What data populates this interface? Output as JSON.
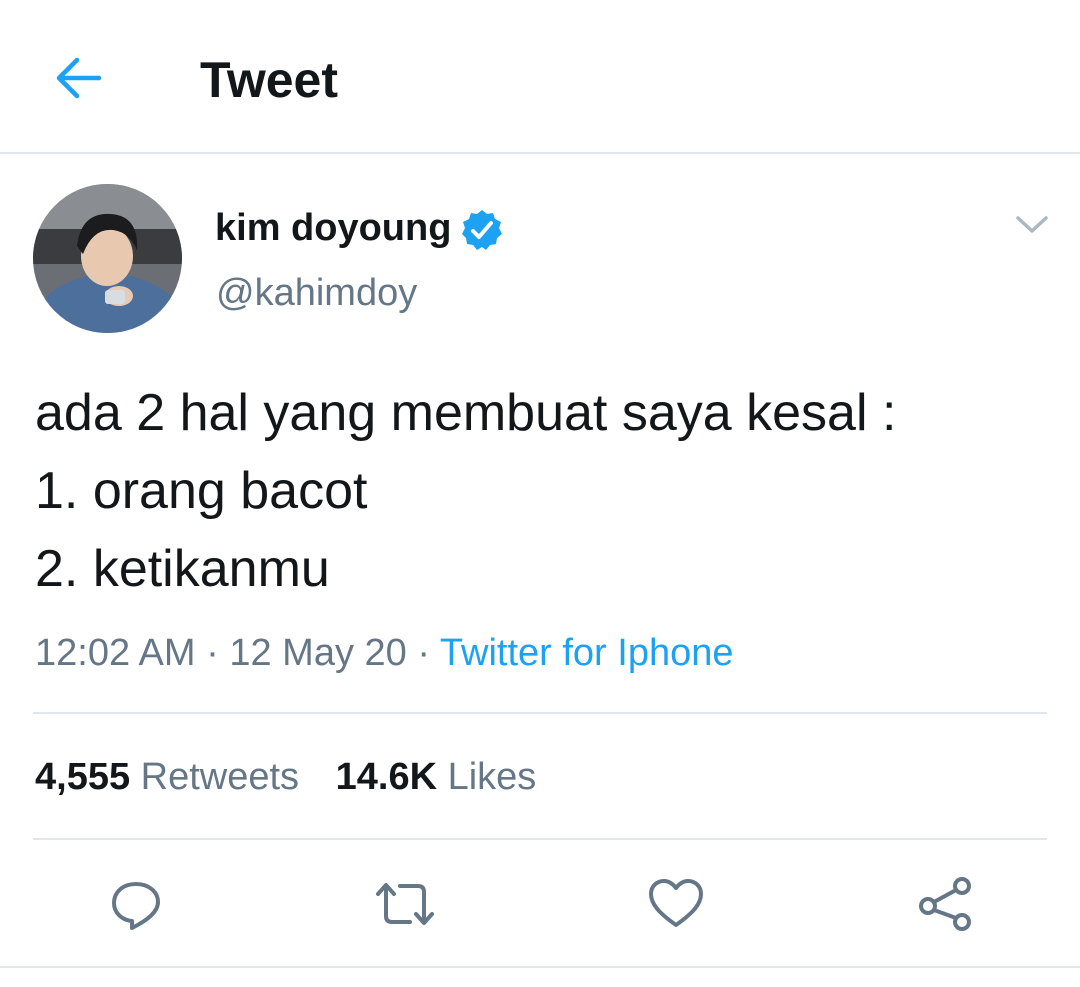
{
  "header": {
    "title": "Tweet",
    "back_icon": "arrow-left-icon"
  },
  "author": {
    "display_name": "kim doyoung",
    "handle": "@kahimdoy",
    "verified": true
  },
  "tweet": {
    "lines": [
      "ada 2 hal yang membuat saya kesal :",
      "1. orang bacot",
      "2. ketikanmu"
    ],
    "time": "12:02 AM",
    "separator": "·",
    "date": "12 May 20",
    "source": "Twitter for Iphone"
  },
  "stats": {
    "retweets_count": "4,555",
    "retweets_label": "Retweets",
    "likes_count": "14.6K",
    "likes_label": "Likes"
  },
  "actions": {
    "icons": [
      "reply-icon",
      "retweet-icon",
      "like-icon",
      "share-icon"
    ]
  },
  "colors": {
    "accent": "#1da1f2",
    "text": "#14171a",
    "secondary": "#657786",
    "divider": "#e1e8ed",
    "action_icon": "#657786"
  }
}
